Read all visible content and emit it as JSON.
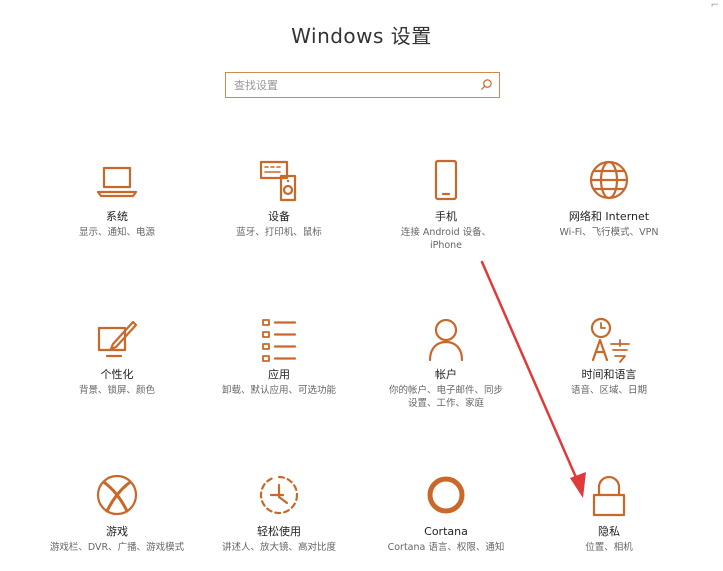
{
  "window": {
    "title": "Windows 设置"
  },
  "search": {
    "placeholder": "查找设置"
  },
  "tiles": [
    {
      "name": "系统",
      "desc": "显示、通知、电源",
      "icon": "laptop-icon"
    },
    {
      "name": "设备",
      "desc": "蓝牙、打印机、鼠标",
      "icon": "devices-icon"
    },
    {
      "name": "手机",
      "desc": "连接 Android 设备、iPhone",
      "icon": "phone-icon"
    },
    {
      "name": "网络和 Internet",
      "desc": "Wi-Fi、飞行模式、VPN",
      "icon": "globe-icon"
    },
    {
      "name": "个性化",
      "desc": "背景、锁屏、颜色",
      "icon": "paint-brush-icon"
    },
    {
      "name": "应用",
      "desc": "卸载、默认应用、可选功能",
      "icon": "apps-list-icon"
    },
    {
      "name": "帐户",
      "desc": "你的帐户、电子邮件、同步设置、工作、家庭",
      "icon": "person-icon"
    },
    {
      "name": "时间和语言",
      "desc": "语音、区域、日期",
      "icon": "time-language-icon"
    },
    {
      "name": "游戏",
      "desc": "游戏栏、DVR、广播、游戏模式",
      "icon": "xbox-icon"
    },
    {
      "name": "轻松使用",
      "desc": "讲述人、放大镜、高对比度",
      "icon": "ease-of-access-icon"
    },
    {
      "name": "Cortana",
      "desc": "Cortana 语言、权限、通知",
      "icon": "cortana-icon"
    },
    {
      "name": "隐私",
      "desc": "位置、相机",
      "icon": "lock-icon"
    }
  ],
  "colors": {
    "accent": "#c8682a",
    "arrow": "#e03a3a"
  },
  "annotation": {
    "type": "red-arrow",
    "points_to": "隐私"
  }
}
